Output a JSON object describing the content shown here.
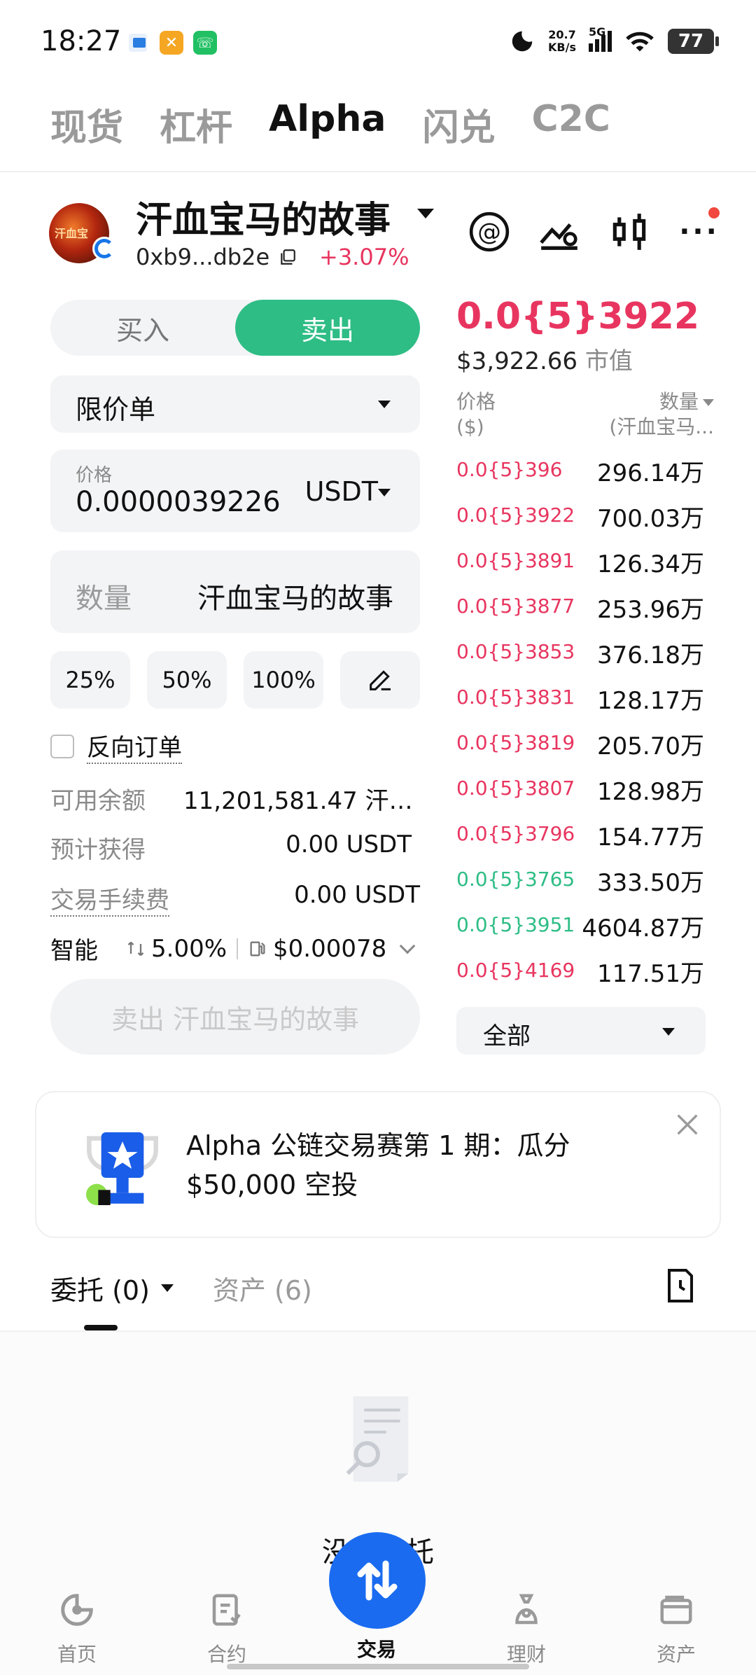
{
  "status_bar": {
    "time": "18:27",
    "net_speed_value": "20.7",
    "net_speed_unit": "KB/s",
    "signal": "5G",
    "battery": "77"
  },
  "top_tabs": [
    "现货",
    "杠杆",
    "Alpha",
    "闪兑",
    "C2C"
  ],
  "token": {
    "name": "汗血宝马的故事",
    "avatar_text": "汗血宝",
    "address": "0xb9...db2e",
    "change": "+3.07%"
  },
  "order_form": {
    "buy_label": "买入",
    "sell_label": "卖出",
    "order_type": "限价单",
    "price_label": "价格",
    "price_value": "0.0000039226",
    "price_unit": "USDT",
    "qty_label": "数量",
    "qty_unit": "汗血宝马的故事",
    "pct_buttons": [
      "25%",
      "50%",
      "100%"
    ],
    "reverse_order_label": "反向订单",
    "available_label": "可用余额",
    "available_value": "11,201,581.47 汗血...",
    "estimated_label": "预计获得",
    "estimated_value": "0.00 USDT",
    "fee_label": "交易手续费",
    "fee_value": "0.00 USDT",
    "smart_label": "智能",
    "slippage": "5.00%",
    "gas": "$0.00078",
    "submit_label": "卖出 汗血宝马的故事"
  },
  "order_book": {
    "last_price": "0.0{5}3922",
    "market_cap_value": "$3,922.66",
    "market_cap_label": "市值",
    "price_header": "价格",
    "price_header_unit": "($)",
    "qty_header": "数量",
    "qty_header_unit": "(汗血宝马...",
    "rows": [
      {
        "price": "0.0{5}396",
        "qty": "296.14万",
        "side": "sell"
      },
      {
        "price": "0.0{5}3922",
        "qty": "700.03万",
        "side": "sell"
      },
      {
        "price": "0.0{5}3891",
        "qty": "126.34万",
        "side": "sell"
      },
      {
        "price": "0.0{5}3877",
        "qty": "253.96万",
        "side": "sell"
      },
      {
        "price": "0.0{5}3853",
        "qty": "376.18万",
        "side": "sell"
      },
      {
        "price": "0.0{5}3831",
        "qty": "128.17万",
        "side": "sell"
      },
      {
        "price": "0.0{5}3819",
        "qty": "205.70万",
        "side": "sell"
      },
      {
        "price": "0.0{5}3807",
        "qty": "128.98万",
        "side": "sell"
      },
      {
        "price": "0.0{5}3796",
        "qty": "154.77万",
        "side": "sell"
      },
      {
        "price": "0.0{5}3765",
        "qty": "333.50万",
        "side": "buy"
      },
      {
        "price": "0.0{5}3951",
        "qty": "4604.87万",
        "side": "buy"
      },
      {
        "price": "0.0{5}4169",
        "qty": "117.51万",
        "side": "sell"
      }
    ],
    "filter": "全部",
    "colors": {
      "sell": "#e8355f",
      "buy": "#2ebd85"
    }
  },
  "banner": {
    "line1": "Alpha 公链交易赛第 1 期：瓜分",
    "line2": "$50,000 空投"
  },
  "sub_tabs": {
    "orders": "委托 (0)",
    "assets": "资产 (6)"
  },
  "empty_state": "没有委托",
  "bottom_nav": [
    "首页",
    "合约",
    "交易",
    "理财",
    "资产"
  ],
  "accent": {
    "sell_green": "#2ebd85",
    "red": "#e8355f",
    "blue": "#1a6bf0"
  }
}
